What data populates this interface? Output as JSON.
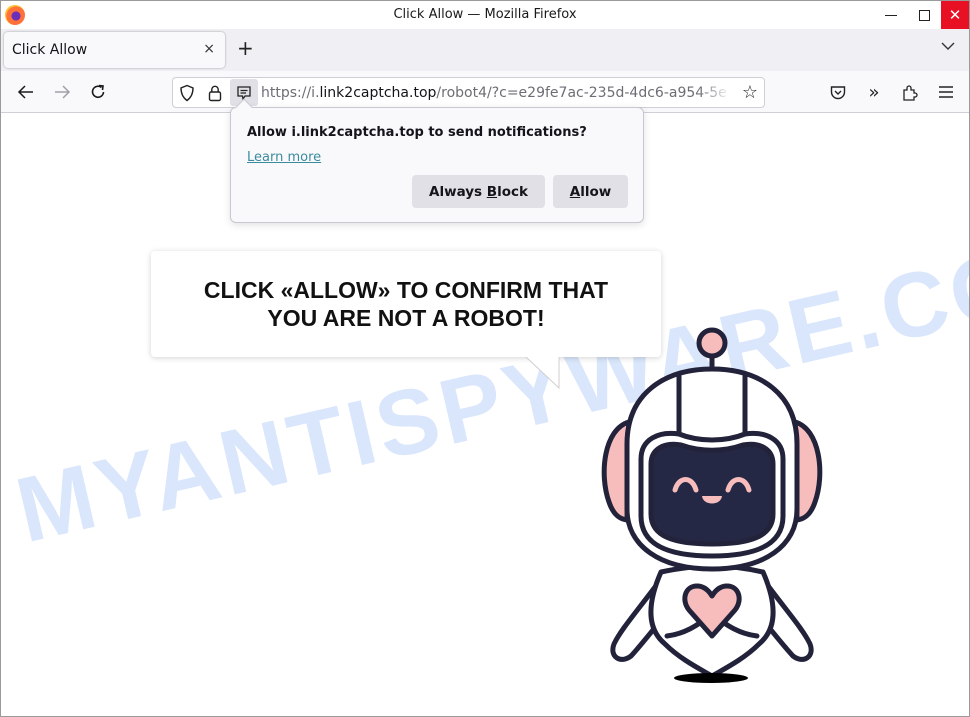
{
  "window": {
    "title": "Click Allow — Mozilla Firefox",
    "controls": {
      "minimize": "—",
      "maximize": "☐",
      "close": "✕"
    }
  },
  "tabs": [
    {
      "title": "Click Allow",
      "close": "×",
      "active": true
    }
  ],
  "tabstrip": {
    "new_tab": "+",
    "list_all_tabs": "⌄"
  },
  "navbar": {
    "back": "←",
    "forward": "→",
    "reload": "↻",
    "url": {
      "scheme": "https://i.",
      "host": "link2captcha.top",
      "path": "/robot4/?c=e29fe7ac-235d-4dc6-a954-5e"
    },
    "bookmark_star": "☆",
    "tools": {
      "pocket": "pocket-icon",
      "overflow": "»",
      "extensions": "extensions-icon",
      "menu": "≡"
    }
  },
  "notification_popup": {
    "title": "Allow i.link2captcha.top to send notifications?",
    "learn_more": "Learn more",
    "block_button": {
      "before": "Always ",
      "accel": "B",
      "after": "lock"
    },
    "allow_button": {
      "before": "",
      "accel": "A",
      "after": "llow"
    }
  },
  "page": {
    "message": "CLICK «ALLOW» TO CONFIRM THAT YOU ARE NOT A ROBOT!",
    "watermark": "MYANTISPYWARE.COM",
    "colors": {
      "robot_outline": "#22223a",
      "robot_visor": "#252844",
      "robot_accent": "#f7bcbc"
    }
  }
}
